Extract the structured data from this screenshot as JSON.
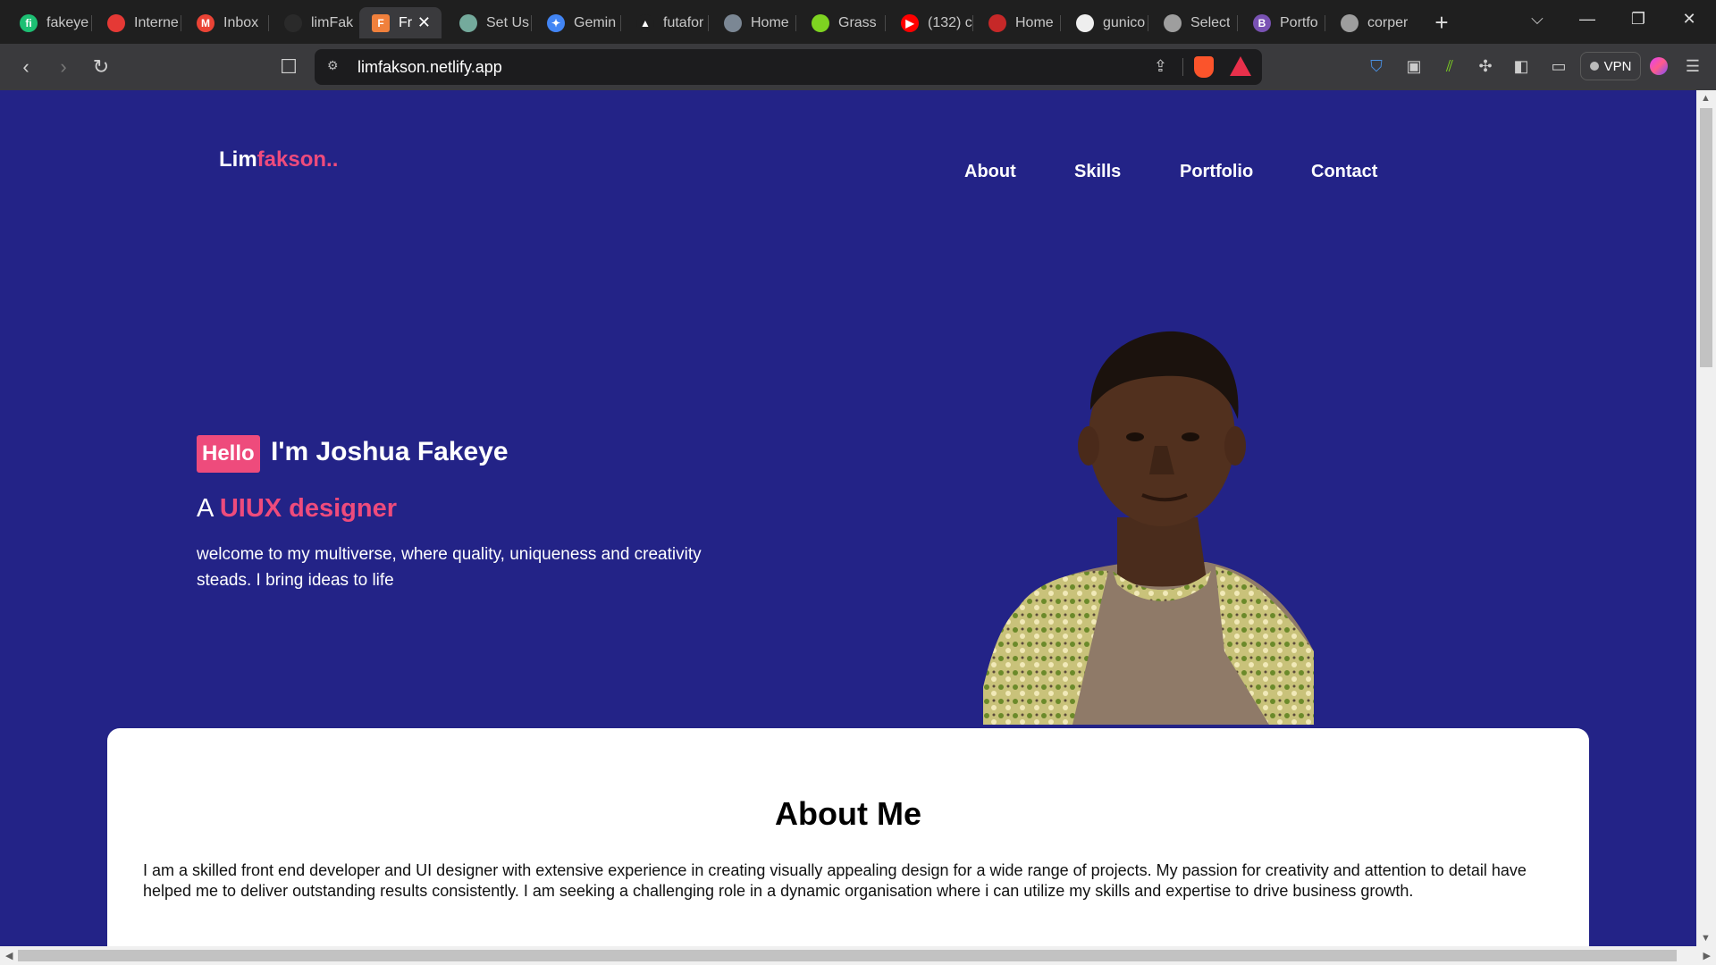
{
  "browser": {
    "tabs": [
      {
        "title": "fakeye",
        "icon": "fiverr-icon",
        "color": "#1dbf73",
        "glyph": "fi"
      },
      {
        "title": "Interne",
        "icon": "speedometer-icon",
        "color": "#e53935",
        "glyph": ""
      },
      {
        "title": "Inbox",
        "icon": "gmail-icon",
        "color": "#ea4335",
        "glyph": "M"
      },
      {
        "title": "limFak",
        "icon": "netlify-icon",
        "color": "#2a2a2a",
        "glyph": ""
      },
      {
        "title": "Fr",
        "icon": "figma-f-icon",
        "color": "#f0803c",
        "glyph": "F",
        "active": true
      },
      {
        "title": "Set Us",
        "icon": "chatgpt-icon",
        "color": "#74aa9c",
        "glyph": ""
      },
      {
        "title": "Gemin",
        "icon": "gemini-icon",
        "color": "#4285f4",
        "glyph": "✦"
      },
      {
        "title": "futafor",
        "icon": "triangle-icon",
        "color": "#1f1f1f",
        "glyph": "▲"
      },
      {
        "title": "Home",
        "icon": "avatar-icon",
        "color": "#7b8794",
        "glyph": ""
      },
      {
        "title": "Grass",
        "icon": "grass-icon",
        "color": "#7ed321",
        "glyph": ""
      },
      {
        "title": "(132) c",
        "icon": "youtube-icon",
        "color": "#ff0000",
        "glyph": "▶"
      },
      {
        "title": "Home",
        "icon": "red-figure-icon",
        "color": "#c62828",
        "glyph": ""
      },
      {
        "title": "gunico",
        "icon": "hexagon-icon",
        "color": "#eeeeee",
        "glyph": ""
      },
      {
        "title": "Select",
        "icon": "globe-icon",
        "color": "#9e9e9e",
        "glyph": ""
      },
      {
        "title": "Portfo",
        "icon": "bootstrap-icon",
        "color": "#7952b3",
        "glyph": "B"
      },
      {
        "title": "corper",
        "icon": "globe-icon",
        "color": "#9e9e9e",
        "glyph": ""
      }
    ],
    "url": "limfakson.netlify.app",
    "vpn_label": "VPN"
  },
  "site": {
    "logo": {
      "part1": "Lim",
      "part2": "fakson.."
    },
    "nav": [
      "About",
      "Skills",
      "Portfolio",
      "Contact"
    ],
    "hero": {
      "badge": "Hello",
      "name": "I'm Joshua Fakeye",
      "role_prefix": "A",
      "role": "UIUX designer",
      "intro": "welcome to my multiverse, where quality, uniqueness and creativity steads. I bring ideas to life"
    },
    "about": {
      "title": "About Me",
      "text": "I am a skilled front end developer and UI designer with extensive experience in creating visually appealing design for a wide range of projects. My passion for creativity and attention to detail have helped me to deliver outstanding results consistently. I am seeking a challenging role in a dynamic organisation where i can utilize my skills and expertise to drive business growth."
    }
  },
  "colors": {
    "page_bg": "#232387",
    "accent": "#ee4b7c",
    "card_bg": "#ffffff"
  }
}
